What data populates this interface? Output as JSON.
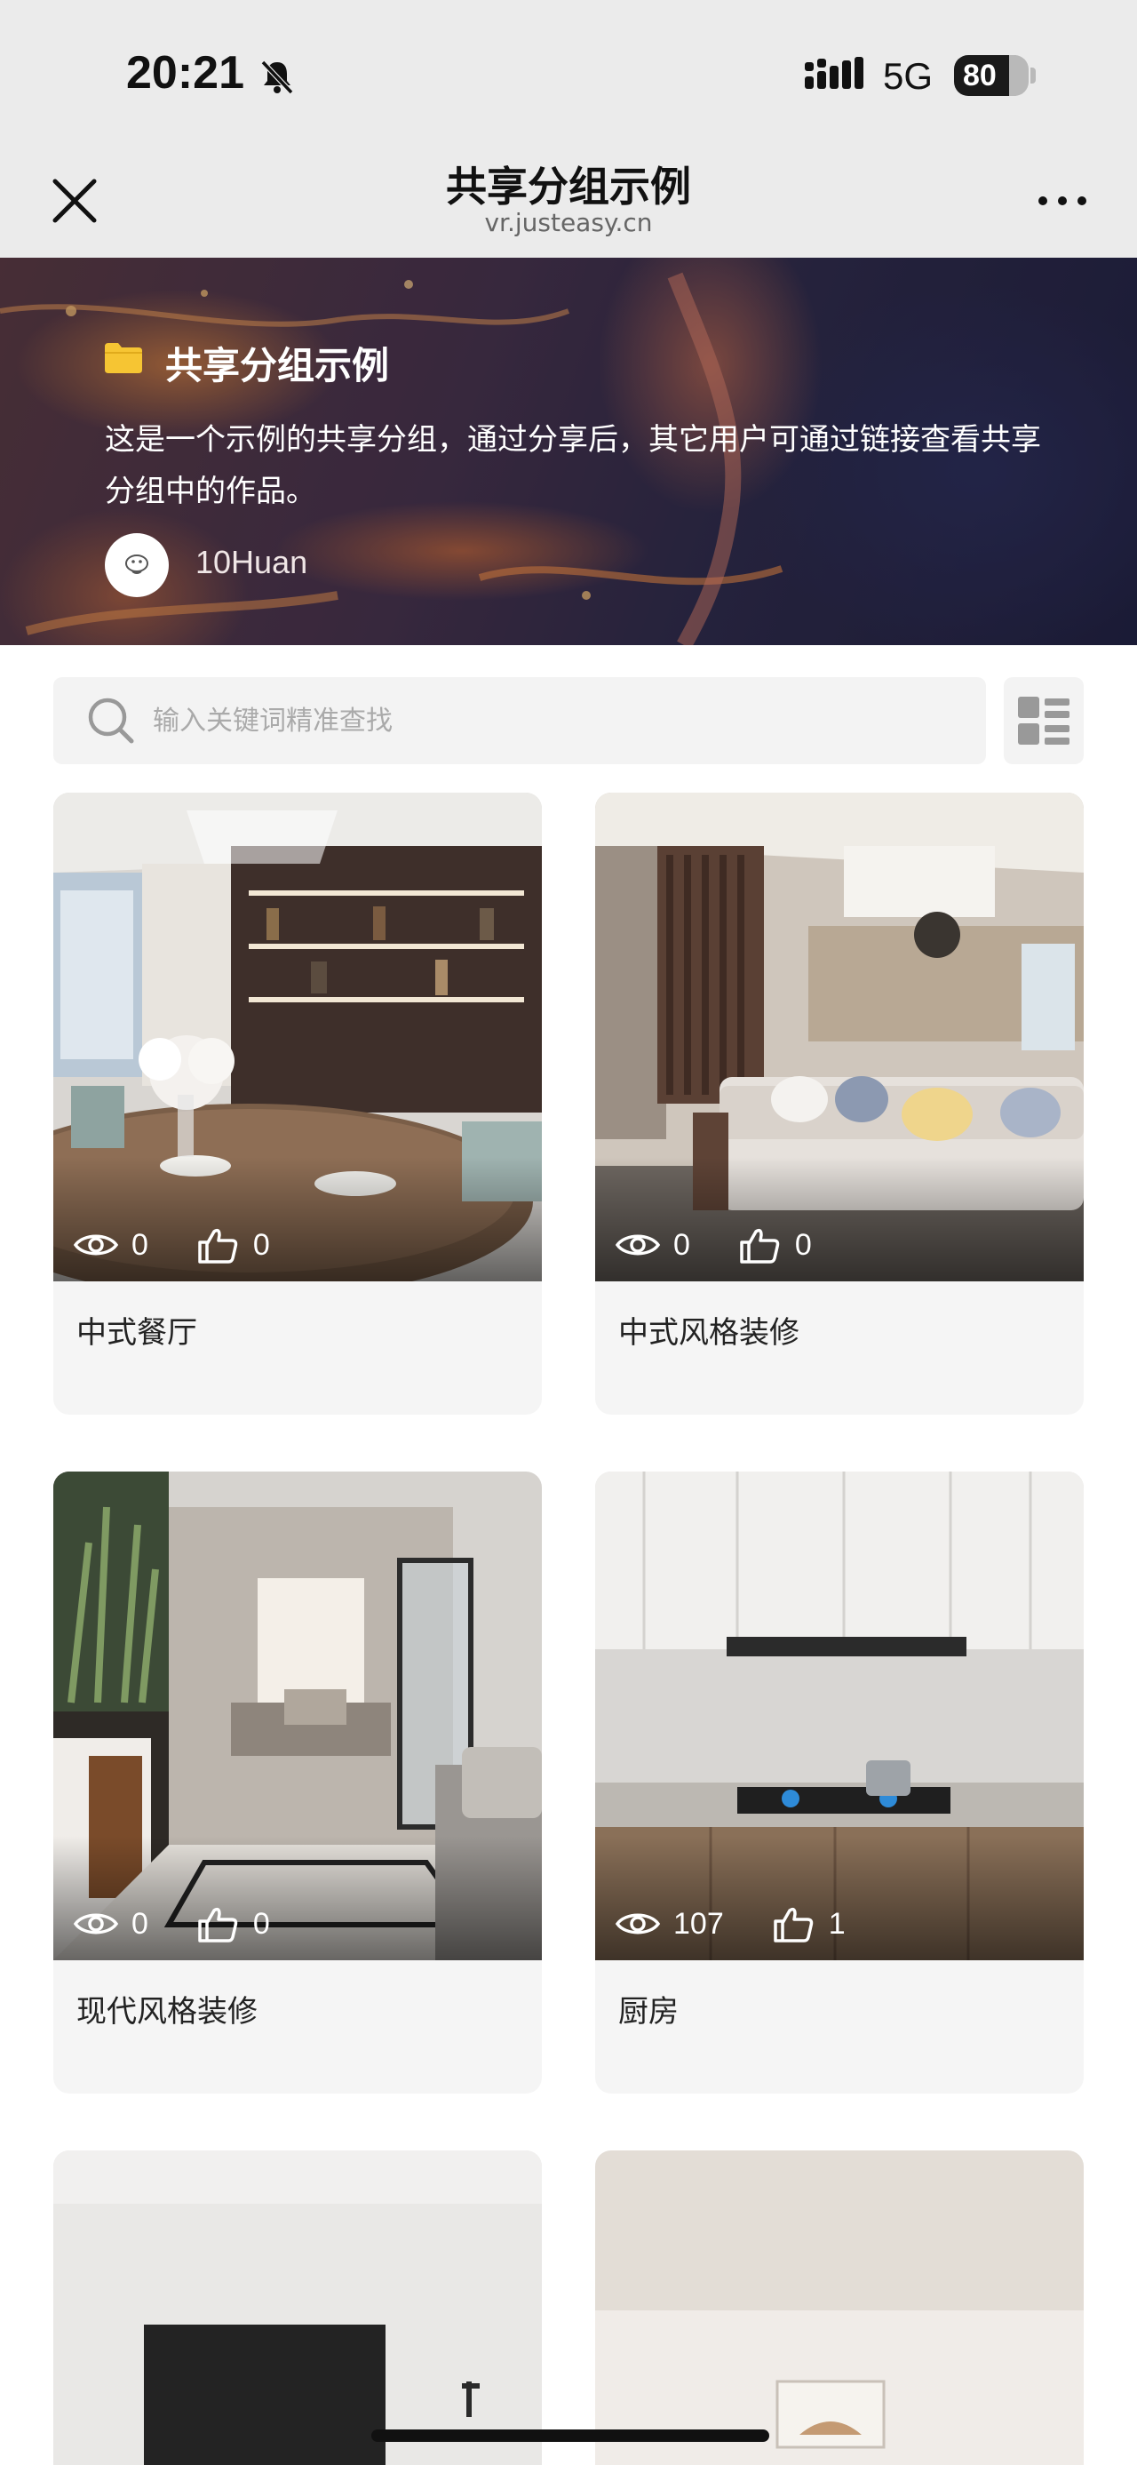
{
  "status_bar": {
    "time": "20:21",
    "network": "5G",
    "battery": "80"
  },
  "nav": {
    "title": "共享分组示例",
    "domain": "vr.justeasy.cn"
  },
  "banner": {
    "group_name": "共享分组示例",
    "description": "这是一个示例的共享分组，通过分享后，其它用户可通过链接查看共享分组中的作品。",
    "author": "10Huan"
  },
  "search": {
    "placeholder": "输入关键词精准查找"
  },
  "cards": [
    {
      "title": "中式餐厅",
      "views": "0",
      "likes": "0"
    },
    {
      "title": "中式风格装修",
      "views": "0",
      "likes": "0"
    },
    {
      "title": "现代风格装修",
      "views": "0",
      "likes": "0"
    },
    {
      "title": "厨房",
      "views": "107",
      "likes": "1"
    }
  ],
  "icons": {
    "close": "close-icon",
    "more": "more-icon",
    "folder": "folder-icon",
    "search": "search-icon",
    "layout": "grid-icon",
    "views": "eye-icon",
    "likes": "thumbs-up-icon"
  },
  "colors": {
    "folder": "#f6c533",
    "chrome": "#ebebeb",
    "card_bg": "#f5f5f5"
  }
}
